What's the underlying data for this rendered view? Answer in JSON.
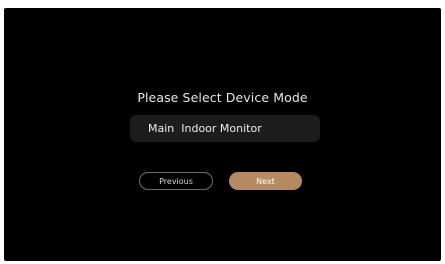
{
  "screen": {
    "title": "Please Select Device Mode",
    "mode_select": {
      "value": "Main  Indoor Monitor"
    },
    "buttons": {
      "previous": "Previous",
      "next": "Next"
    }
  },
  "colors": {
    "background": "#000000",
    "accent": "#b58a63",
    "field": "#1c1c1c",
    "outline": "#6e6e6e"
  }
}
